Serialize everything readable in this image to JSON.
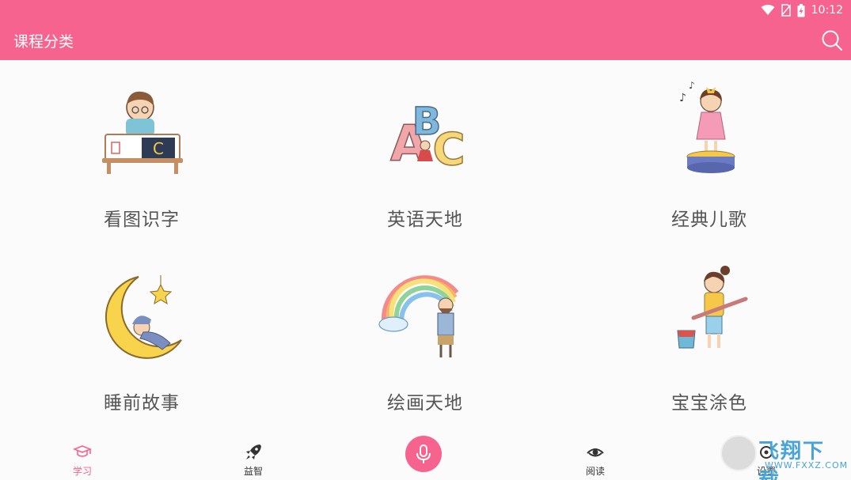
{
  "status_bar": {
    "time": "10:12"
  },
  "app_bar": {
    "title": "课程分类"
  },
  "categories": [
    {
      "label": "看图识字",
      "icon": "boy-reading-icon"
    },
    {
      "label": "英语天地",
      "icon": "abc-letters-icon"
    },
    {
      "label": "经典儿歌",
      "icon": "girl-singing-icon"
    },
    {
      "label": "睡前故事",
      "icon": "moon-sleeping-icon"
    },
    {
      "label": "绘画天地",
      "icon": "rainbow-painter-icon"
    },
    {
      "label": "宝宝涂色",
      "icon": "girl-paintbrush-icon"
    }
  ],
  "bottom_nav": {
    "items": [
      {
        "label": "学习",
        "icon": "graduation-cap-icon",
        "active": true
      },
      {
        "label": "益智",
        "icon": "rocket-icon",
        "active": false
      },
      {
        "label": "阅读",
        "icon": "eye-icon",
        "active": false
      },
      {
        "label": "设置",
        "icon": "settings-icon",
        "active": false
      }
    ],
    "mic": {
      "icon": "microphone-icon"
    }
  },
  "watermark": {
    "text": "飞翔下载",
    "sub": "WWW.FXXZ.COM"
  },
  "colors": {
    "accent": "#f7638f",
    "label": "#555555",
    "background": "#fbfbfb"
  }
}
